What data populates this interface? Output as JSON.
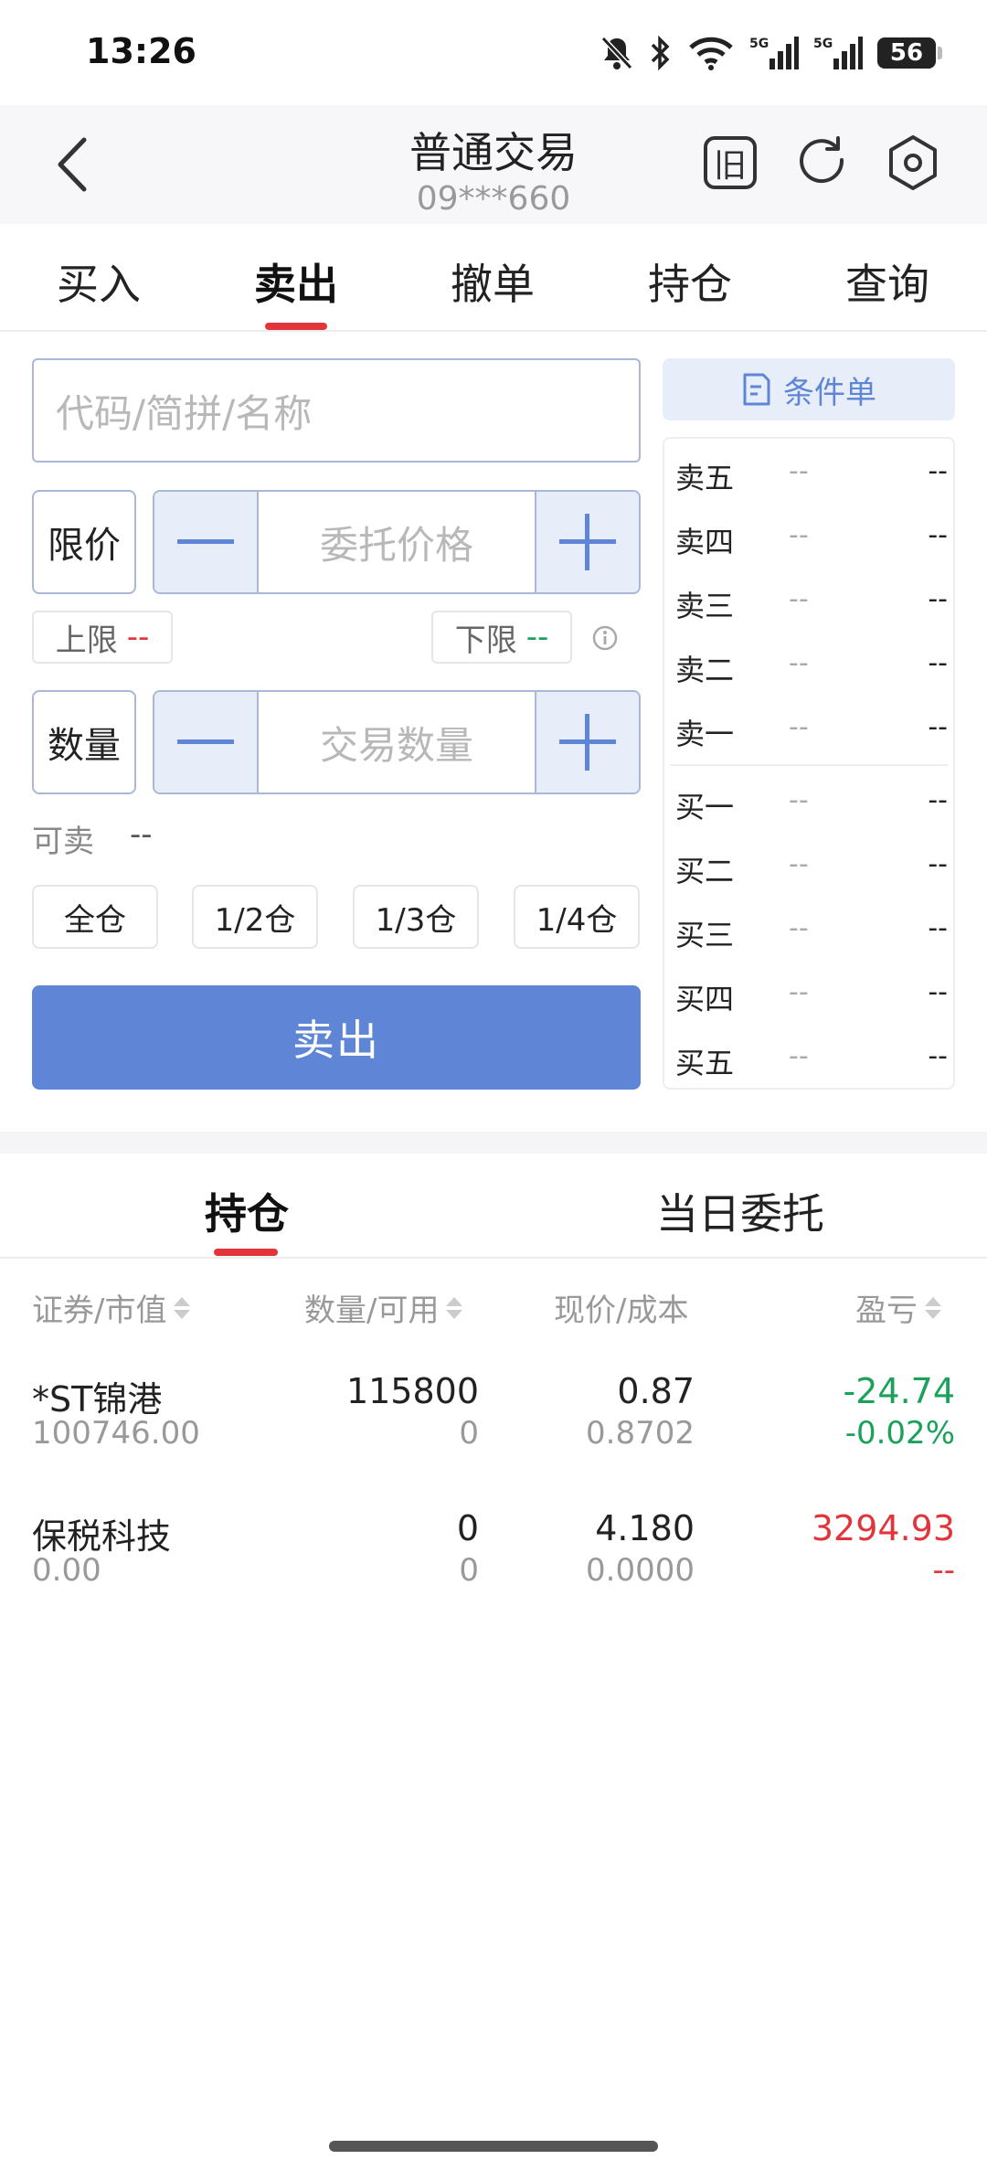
{
  "status_bar": {
    "time": "13:26",
    "battery": "56",
    "icons": [
      "bell-off-icon",
      "bluetooth-icon",
      "wifi-icon",
      "signal-5g-icon",
      "signal-5g-icon",
      "battery-icon"
    ]
  },
  "header": {
    "title": "普通交易",
    "account": "09***660",
    "old_label": "旧"
  },
  "tabs": [
    {
      "label": "买入",
      "active": false
    },
    {
      "label": "卖出",
      "active": true
    },
    {
      "label": "撤单",
      "active": false
    },
    {
      "label": "持仓",
      "active": false
    },
    {
      "label": "查询",
      "active": false
    }
  ],
  "form": {
    "search_placeholder": "代码/简拼/名称",
    "price_type": "限价",
    "price_placeholder": "委托价格",
    "upper_label": "上限",
    "upper_value": "--",
    "lower_label": "下限",
    "lower_value": "--",
    "qty_label": "数量",
    "qty_placeholder": "交易数量",
    "available_label": "可卖",
    "available_value": "--",
    "ratios": [
      "全仓",
      "1/2仓",
      "1/3仓",
      "1/4仓"
    ],
    "submit_label": "卖出"
  },
  "order_book": {
    "condition_label": "条件单",
    "asks": [
      {
        "label": "卖五",
        "price": "--",
        "volume": "--"
      },
      {
        "label": "卖四",
        "price": "--",
        "volume": "--"
      },
      {
        "label": "卖三",
        "price": "--",
        "volume": "--"
      },
      {
        "label": "卖二",
        "price": "--",
        "volume": "--"
      },
      {
        "label": "卖一",
        "price": "--",
        "volume": "--"
      }
    ],
    "bids": [
      {
        "label": "买一",
        "price": "--",
        "volume": "--"
      },
      {
        "label": "买二",
        "price": "--",
        "volume": "--"
      },
      {
        "label": "买三",
        "price": "--",
        "volume": "--"
      },
      {
        "label": "买四",
        "price": "--",
        "volume": "--"
      },
      {
        "label": "买五",
        "price": "--",
        "volume": "--"
      }
    ]
  },
  "positions_tabs": [
    {
      "label": "持仓",
      "active": true
    },
    {
      "label": "当日委托",
      "active": false
    }
  ],
  "table": {
    "headers": [
      "证券/市值",
      "数量/可用",
      "现价/成本",
      "盈亏"
    ],
    "rows": [
      {
        "name": "*ST锦港",
        "market_value": "100746.00",
        "qty": "115800",
        "available": "0",
        "price": "0.87",
        "cost": "0.8702",
        "pnl": "-24.74",
        "pnl_pct": "-0.02%",
        "pnl_color": "#1aa25a"
      },
      {
        "name": "保税科技",
        "market_value": "0.00",
        "qty": "0",
        "available": "0",
        "price": "4.180",
        "cost": "0.0000",
        "pnl": "3294.93",
        "pnl_pct": "--",
        "pnl_color": "#e2353b"
      }
    ]
  },
  "colors": {
    "accent": "#5e85d6",
    "active_red": "#e2353b",
    "gain_red": "#e2353b",
    "loss_green": "#1aa25a"
  }
}
